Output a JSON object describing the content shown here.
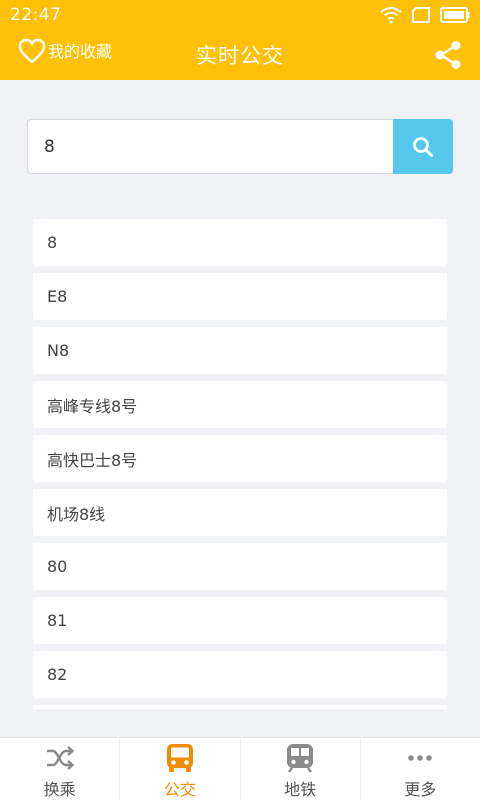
{
  "status_bar": {
    "time": "22:47",
    "icons": [
      "wifi-icon",
      "sim-card-icon",
      "battery-icon"
    ]
  },
  "header": {
    "favorites_label": "我的收藏",
    "favorites_icon": "heart-icon",
    "title": "实时公交",
    "share_icon": "share-icon",
    "background_color": "#ffc107"
  },
  "search": {
    "value": "8",
    "button_icon": "search-icon",
    "button_color": "#56c8ee"
  },
  "results": [
    {
      "label": "8"
    },
    {
      "label": "E8"
    },
    {
      "label": "N8"
    },
    {
      "label": "高峰专线8号"
    },
    {
      "label": "高快巴士8号"
    },
    {
      "label": "机场8线"
    },
    {
      "label": "80"
    },
    {
      "label": "81"
    },
    {
      "label": "82"
    },
    {
      "label": ""
    }
  ],
  "tabs": [
    {
      "label": "换乘",
      "icon": "shuffle-icon",
      "active": false
    },
    {
      "label": "公交",
      "icon": "bus-icon",
      "active": true
    },
    {
      "label": "地铁",
      "icon": "subway-icon",
      "active": false
    },
    {
      "label": "更多",
      "icon": "more-icon",
      "active": false
    }
  ],
  "colors": {
    "active_tab": "#f08c00",
    "inactive_tab": "#8a8a8a"
  }
}
